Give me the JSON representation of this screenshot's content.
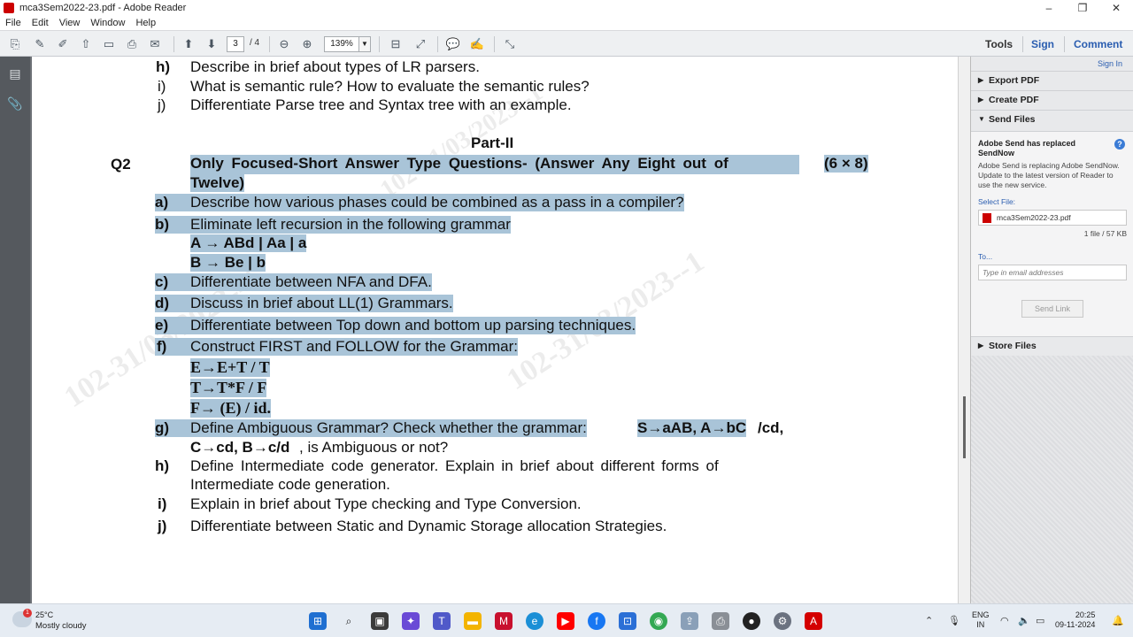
{
  "window": {
    "title": "mca3Sem2022-23.pdf - Adobe Reader",
    "minimize": "–",
    "maximize": "❐",
    "close": "✕"
  },
  "menu": [
    "File",
    "Edit",
    "View",
    "Window",
    "Help"
  ],
  "toolbar": {
    "page_current": "3",
    "page_total": "/ 4",
    "zoom": "139%",
    "tools_label": "Tools",
    "sign_label": "Sign",
    "comment_label": "Comment"
  },
  "document": {
    "top_items": [
      {
        "label": "h)",
        "text": "Describe in brief about types of LR parsers."
      },
      {
        "label": "i)",
        "text": "What is semantic rule? How to evaluate the semantic rules?"
      },
      {
        "label": "j)",
        "text": "Differentiate Parse tree and Syntax tree with an example."
      }
    ],
    "part_heading": "Part-II",
    "q_label": "Q2",
    "q_heading_line1": "Only Focused-Short Answer Type Questions- (Answer Any Eight out of",
    "q_heading_line2": "Twelve)",
    "q_marks": "(6 × 8)",
    "items": [
      {
        "label": "a)",
        "text": "Describe how various phases could be combined as a pass in a compiler?"
      },
      {
        "label": "b)",
        "text": "Eliminate left recursion in the following grammar"
      },
      {
        "label": "c)",
        "text": "Differentiate between NFA and DFA."
      },
      {
        "label": "d)",
        "text": "Discuss in brief about LL(1) Grammars."
      },
      {
        "label": "e)",
        "text": "Differentiate between Top down and bottom up parsing techniques."
      },
      {
        "label": "f)",
        "text": "Construct FIRST and FOLLOW for the Grammar:"
      },
      {
        "label": "g)",
        "text": "Define Ambiguous Grammar? Check whether the grammar:"
      },
      {
        "label": "h)",
        "text": "Define Intermediate code generator. Explain in brief about different forms of"
      },
      {
        "label": "i)",
        "text": "Explain in brief about Type checking and Type Conversion."
      },
      {
        "label": "j)",
        "text": "Differentiate between Static and Dynamic Storage allocation Strategies."
      }
    ],
    "grammar_b1": "A → ABd | Aa | a",
    "grammar_b2": "B → Be | b",
    "grammar_f1": "E→E+T / T",
    "grammar_f2": "T→T*F / F",
    "grammar_f3": "F→ (E) / id.",
    "g_bold1": "S→aAB, A→bC",
    "g_tail1": "/cd,",
    "g_bold2": "C→cd, B→c/d",
    "g_tail2": ", is Ambiguous or not?",
    "h_line2": "Intermediate code generation.",
    "watermark": "102-31/03/2023--1"
  },
  "right_pane": {
    "signin": "Sign In",
    "export_pdf": "Export PDF",
    "create_pdf": "Create PDF",
    "send_files": "Send Files",
    "send_title": "Adobe Send has replaced SendNow",
    "send_desc": "Adobe Send is replacing Adobe SendNow. Update to the latest version of Reader to use the new service.",
    "select_file_label": "Select File:",
    "file_name": "mca3Sem2022-23.pdf",
    "file_count": "1 file / 57 KB",
    "to_label": "To...",
    "to_placeholder": "Type in email addresses",
    "send_link": "Send Link",
    "store_files": "Store Files"
  },
  "taskbar": {
    "temperature": "25°C",
    "weather": "Mostly cloudy",
    "notification_count": "1",
    "lang_line1": "ENG",
    "lang_line2": "IN",
    "time": "20:25",
    "date": "09-11-2024"
  }
}
